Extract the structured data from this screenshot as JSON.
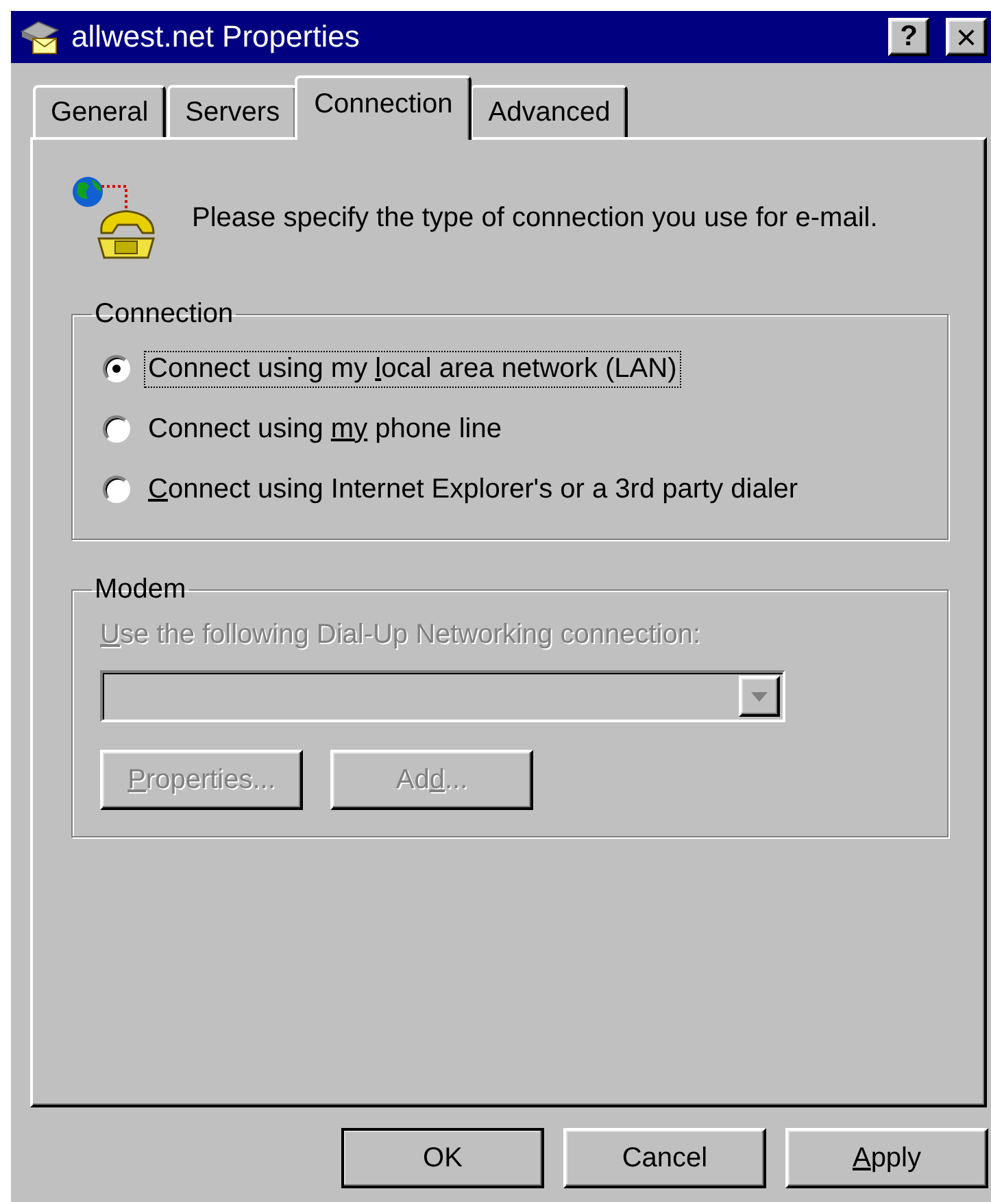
{
  "window": {
    "title": "allwest.net Properties",
    "title_buttons": [
      {
        "kind": "help",
        "label": "?"
      },
      {
        "kind": "close",
        "label": "×"
      }
    ]
  },
  "tabs": [
    {
      "label": "General",
      "selected": false
    },
    {
      "label": "Servers",
      "selected": false
    },
    {
      "label": "Connection",
      "selected": true
    },
    {
      "label": "Advanced",
      "selected": false
    }
  ],
  "intro": "Please specify the type of connection you use for e-mail.",
  "connection_group": {
    "title": "Connection",
    "options": [
      {
        "label": [
          "Connect using my ",
          {
            "underline": "l"
          },
          "ocal area network (LAN)"
        ],
        "selected": true,
        "focused": true
      },
      {
        "label": [
          "Connect using ",
          {
            "underline": "my"
          },
          " phone line"
        ],
        "selected": false,
        "focused": false
      },
      {
        "label": [
          {
            "underline": "C"
          },
          "onnect using Internet Explorer's or a 3rd party dialer"
        ],
        "selected": false,
        "focused": false
      }
    ]
  },
  "modem_group": {
    "title": "Modem",
    "disabled": true,
    "label": [
      {
        "underline": "U"
      },
      "se the following Dial-Up Networking connection:"
    ],
    "buttons": [
      {
        "label": [
          {
            "underline": "P"
          },
          "roperties..."
        ]
      },
      {
        "label": [
          "Ad",
          {
            "underline": "d"
          },
          "..."
        ]
      }
    ]
  },
  "buttons": [
    {
      "label": [
        "OK"
      ],
      "default": true
    },
    {
      "label": [
        "Cancel"
      ],
      "default": false
    },
    {
      "label": [
        {
          "underline": "A"
        },
        "pply"
      ],
      "default": false
    }
  ]
}
